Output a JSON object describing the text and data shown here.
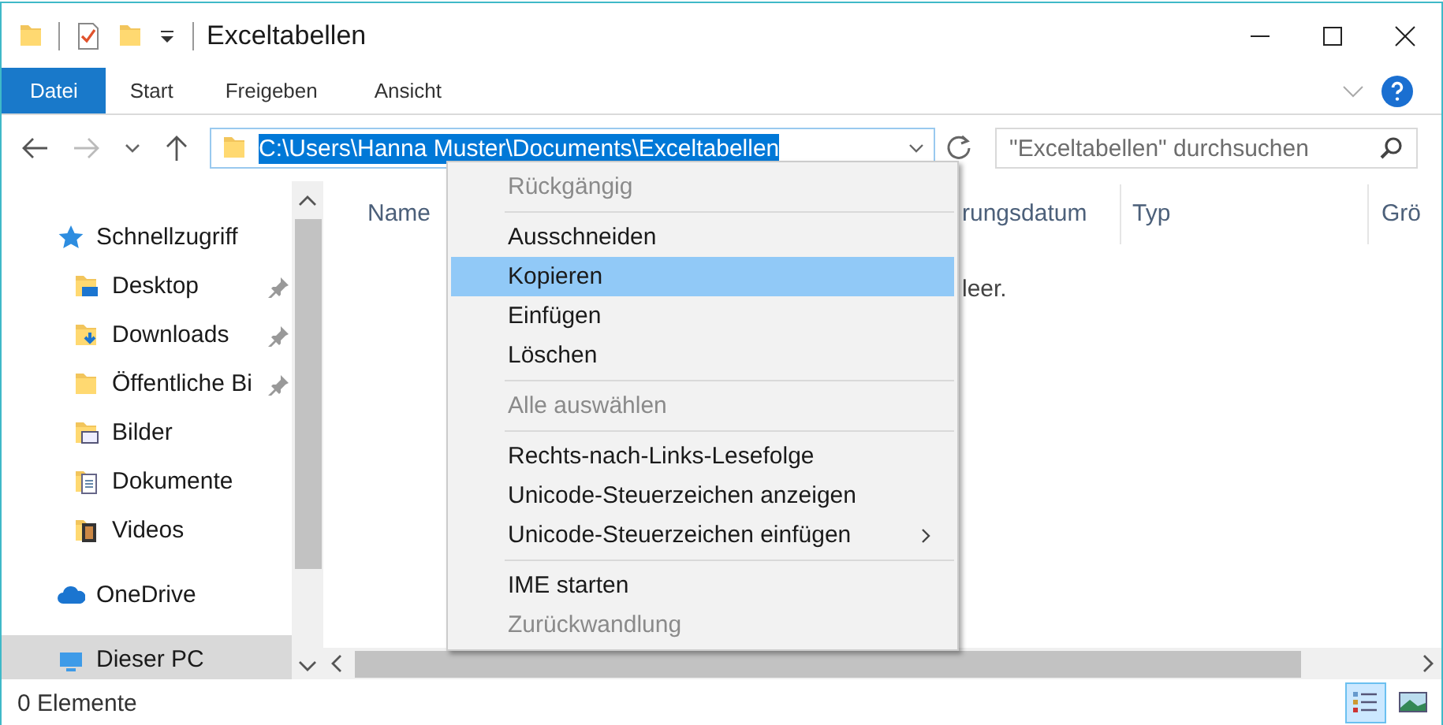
{
  "window": {
    "title": "Exceltabellen"
  },
  "ribbon_tabs": [
    {
      "label": "Datei",
      "selected": true
    },
    {
      "label": "Start",
      "selected": false
    },
    {
      "label": "Freigeben",
      "selected": false
    },
    {
      "label": "Ansicht",
      "selected": false
    }
  ],
  "address_bar": {
    "value": "C:\\Users\\Hanna Muster\\Documents\\Exceltabellen",
    "selected": true
  },
  "search": {
    "placeholder": "\"Exceltabellen\" durchsuchen"
  },
  "sidebar": {
    "items": [
      {
        "label": "Schnellzugriff",
        "kind": "star",
        "selected": false,
        "children": [
          {
            "label": "Desktop",
            "kind": "desktop",
            "pinned": true,
            "selected": false
          },
          {
            "label": "Downloads",
            "kind": "downloads",
            "pinned": true,
            "selected": false
          },
          {
            "label": "Öffentliche Bi",
            "kind": "folder",
            "pinned": true,
            "selected": false
          },
          {
            "label": "Bilder",
            "kind": "pictures",
            "pinned": false,
            "selected": false
          },
          {
            "label": "Dokumente",
            "kind": "documents",
            "pinned": false,
            "selected": false
          },
          {
            "label": "Videos",
            "kind": "videos",
            "pinned": false,
            "selected": false
          }
        ]
      },
      {
        "label": "OneDrive",
        "kind": "cloud",
        "selected": false
      },
      {
        "label": "Dieser PC",
        "kind": "pc",
        "selected": true
      }
    ]
  },
  "table": {
    "columns": [
      "Name",
      "rungsdatum",
      "Typ",
      "Grö"
    ],
    "empty_message": "leer."
  },
  "context_menu": {
    "items": [
      {
        "label": "Rückgängig",
        "kind": "item",
        "disabled": true,
        "selected": false
      },
      {
        "kind": "separator"
      },
      {
        "label": "Ausschneiden",
        "kind": "item",
        "disabled": false,
        "selected": false
      },
      {
        "label": "Kopieren",
        "kind": "item",
        "disabled": false,
        "selected": true
      },
      {
        "label": "Einfügen",
        "kind": "item",
        "disabled": false,
        "selected": false
      },
      {
        "label": "Löschen",
        "kind": "item",
        "disabled": false,
        "selected": false
      },
      {
        "kind": "separator"
      },
      {
        "label": "Alle auswählen",
        "kind": "item",
        "disabled": true,
        "selected": false
      },
      {
        "kind": "separator"
      },
      {
        "label": "Rechts-nach-Links-Lesefolge",
        "kind": "item",
        "disabled": false,
        "selected": false
      },
      {
        "label": "Unicode-Steuerzeichen anzeigen",
        "kind": "item",
        "disabled": false,
        "selected": false
      },
      {
        "label": "Unicode-Steuerzeichen einfügen",
        "kind": "submenu",
        "disabled": false,
        "selected": false
      },
      {
        "kind": "separator"
      },
      {
        "label": "IME starten",
        "kind": "item",
        "disabled": false,
        "selected": false
      },
      {
        "label": "Zurückwandlung",
        "kind": "item",
        "disabled": true,
        "selected": false
      }
    ]
  },
  "status_bar": {
    "text": "0 Elemente",
    "views": [
      {
        "kind": "details",
        "selected": true
      },
      {
        "kind": "tiles",
        "selected": false
      }
    ]
  }
}
